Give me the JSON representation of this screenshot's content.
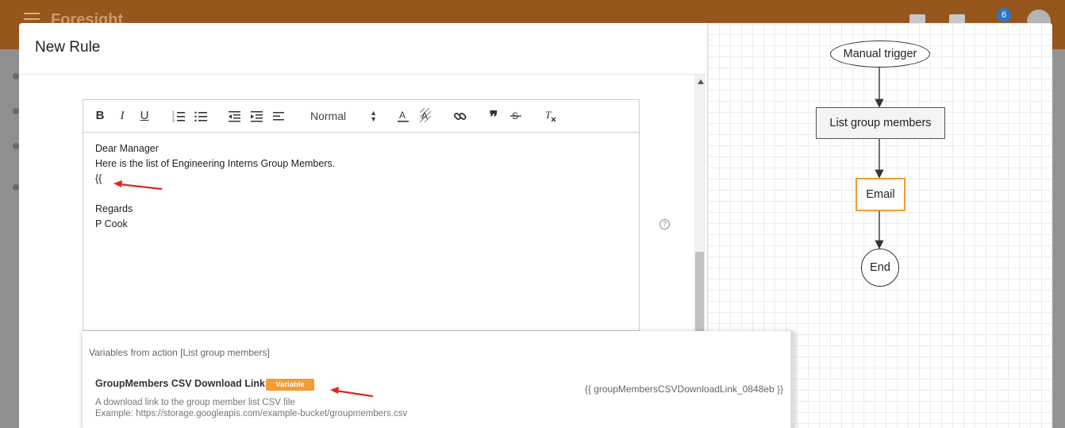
{
  "app": {
    "brand": "Foresight",
    "notification_count": "6"
  },
  "dialog": {
    "title": "New Rule"
  },
  "editor": {
    "toolbar": {
      "bold": "B",
      "italic": "I",
      "underline": "U",
      "heading_select": "Normal"
    },
    "lines": [
      "Dear Manager",
      "Here is the list of Engineering Interns Group Members.",
      "{{",
      "",
      "Regards",
      "P Cook"
    ],
    "help_glyph": "?"
  },
  "variables": {
    "header": "Variables from action [List group members]",
    "items": [
      {
        "name": "GroupMembers CSV Download Link",
        "badge": "Variable",
        "token": "{{ groupMembersCSVDownloadLink_0848eb }}",
        "description": "A download link to the group member list CSV file",
        "example": "Example: https://storage.googleapis.com/example-bucket/groupmembers.csv"
      }
    ]
  },
  "flow": {
    "nodes": [
      "Manual trigger",
      "List group members",
      "Email",
      "End"
    ],
    "active_node": "Email"
  },
  "colors": {
    "appbar": "#97561c",
    "accent_orange": "#f39c34",
    "annotation_arrow": "#e3241f",
    "badge_blue": "#2b76c9"
  },
  "icons": {
    "toolbar": [
      "bold-icon",
      "italic-icon",
      "underline-icon",
      "ordered-list-icon",
      "bullet-list-icon",
      "outdent-icon",
      "indent-icon",
      "align-icon",
      "text-color-icon",
      "highlight-icon",
      "link-icon",
      "quote-icon",
      "strike-icon",
      "clear-format-icon"
    ]
  }
}
